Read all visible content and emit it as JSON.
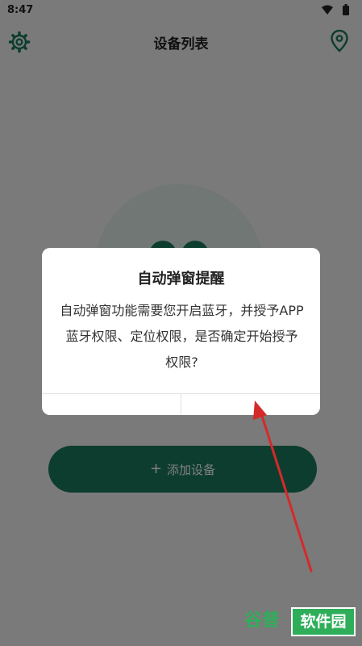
{
  "status_bar": {
    "time": "8:47",
    "wifi_icon": "wifi-icon",
    "battery_icon": "battery-icon"
  },
  "app_bar": {
    "title": "设备列表",
    "left_icon": "settings-gear-icon",
    "right_icon": "location-pin-icon"
  },
  "main": {
    "add_device_label": "添加设备",
    "add_device_icon": "plus-icon"
  },
  "dialog": {
    "title": "自动弹窗提醒",
    "message": "自动弹窗功能需要您开启蓝牙，并授予APP蓝牙权限、定位权限，是否确定开始授予权限?",
    "cancel_label": "",
    "confirm_label": ""
  },
  "watermark": {
    "left_text": "谷普",
    "box_text": "软件园"
  },
  "colors": {
    "brand_green": "#1a7a5e",
    "overlay": "rgba(0,0,0,0.5)",
    "annotation_red": "#d42a2a"
  }
}
